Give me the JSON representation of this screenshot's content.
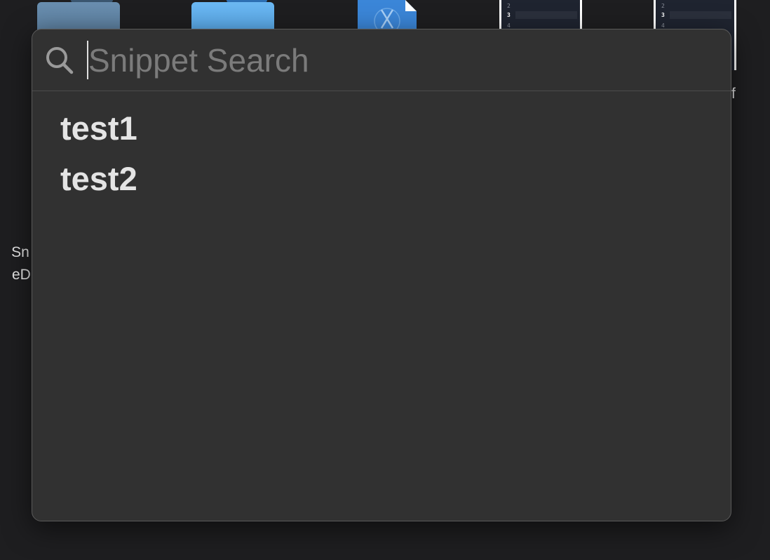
{
  "desktop": {
    "icons": [
      {
        "kind": "folder",
        "color": "#6a8fb0"
      },
      {
        "kind": "folder",
        "color": "#6cb8f2"
      },
      {
        "kind": "xcode-document",
        "color": "#3b86d8"
      },
      {
        "kind": "screenshot",
        "lines": [
          "2",
          "3",
          "4"
        ]
      },
      {
        "kind": "screenshot",
        "lines": [
          "2",
          "3",
          "4"
        ]
      }
    ],
    "label_left_line1": "Sn",
    "label_left_line2": "eD",
    "label_right": "f"
  },
  "snippet_search": {
    "placeholder": "Snippet Search",
    "value": "",
    "results": [
      {
        "label": "test1"
      },
      {
        "label": "test2"
      }
    ]
  },
  "colors": {
    "desktop_bg": "#1e1e20",
    "panel_bg": "#313131",
    "text": "#e4e4e4",
    "placeholder": "#7b7b7b"
  }
}
